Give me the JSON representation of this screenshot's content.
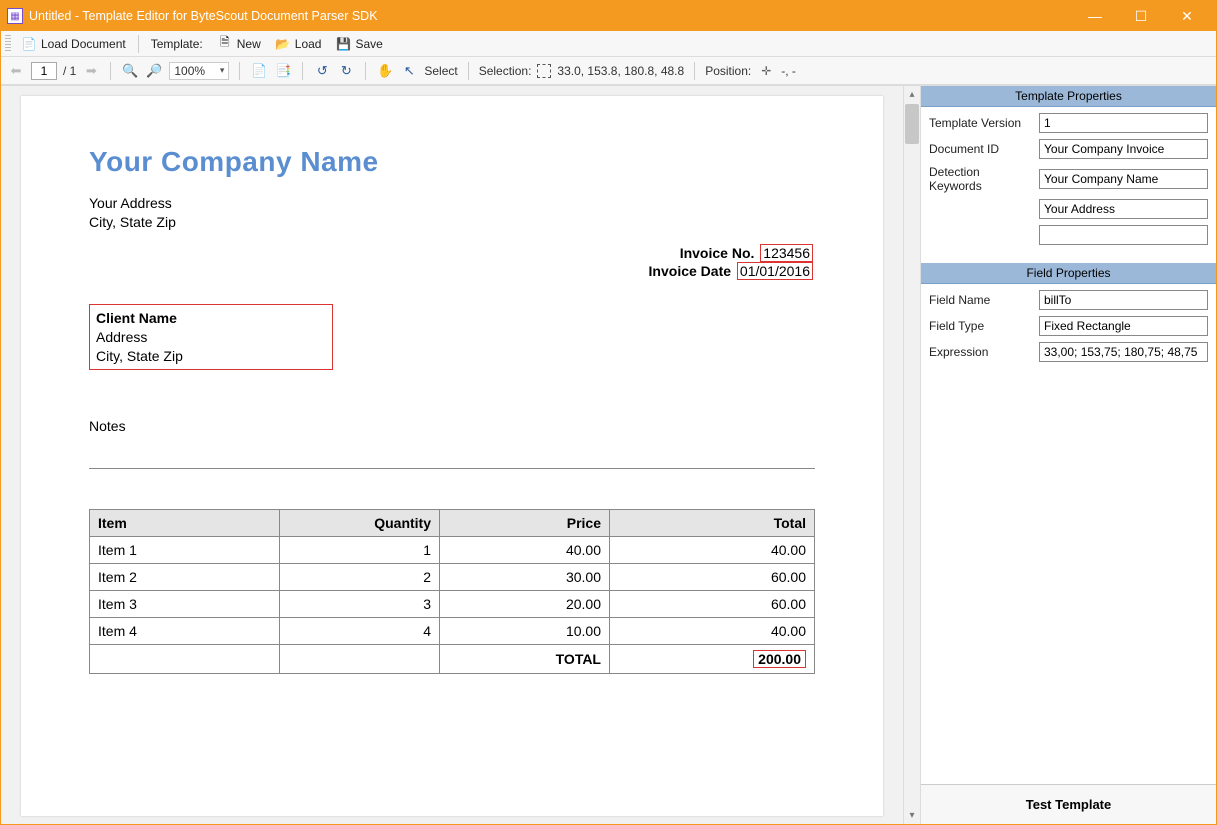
{
  "title": "Untitled - Template Editor for ByteScout Document Parser SDK",
  "menubar": {
    "load_document": "Load Document",
    "template_label": "Template:",
    "new": "New",
    "load": "Load",
    "save": "Save"
  },
  "toolbar": {
    "page_current": "1",
    "page_total": "/ 1",
    "zoom": "100%",
    "select": "Select",
    "selection_label": "Selection:",
    "selection_value": "33.0, 153.8, 180.8, 48.8",
    "position_label": "Position:",
    "position_value": "-, -"
  },
  "doc": {
    "company": "Your Company Name",
    "address1": "Your Address",
    "address2": "City, State Zip",
    "invoice_no_label": "Invoice No.",
    "invoice_no": "123456",
    "invoice_date_label": "Invoice Date",
    "invoice_date": "01/01/2016",
    "client_name": "Client Name",
    "client_addr1": "Address",
    "client_addr2": "City, State Zip",
    "notes_label": "Notes",
    "table": {
      "headers": [
        "Item",
        "Quantity",
        "Price",
        "Total"
      ],
      "rows": [
        [
          "Item 1",
          "1",
          "40.00",
          "40.00"
        ],
        [
          "Item 2",
          "2",
          "30.00",
          "60.00"
        ],
        [
          "Item 3",
          "3",
          "20.00",
          "60.00"
        ],
        [
          "Item 4",
          "4",
          "10.00",
          "40.00"
        ]
      ],
      "total_label": "TOTAL",
      "total_value": "200.00"
    }
  },
  "template_props": {
    "header": "Template Properties",
    "version_label": "Template Version",
    "version": "1",
    "docid_label": "Document ID",
    "docid": "Your Company Invoice",
    "keywords_label": "Detection Keywords",
    "keywords": [
      "Your Company Name",
      "Your Address",
      ""
    ]
  },
  "field_props": {
    "header": "Field Properties",
    "name_label": "Field Name",
    "name": "billTo",
    "type_label": "Field Type",
    "type": "Fixed Rectangle",
    "expr_label": "Expression",
    "expr": "33,00; 153,75; 180,75; 48,75"
  },
  "test_button": "Test Template"
}
